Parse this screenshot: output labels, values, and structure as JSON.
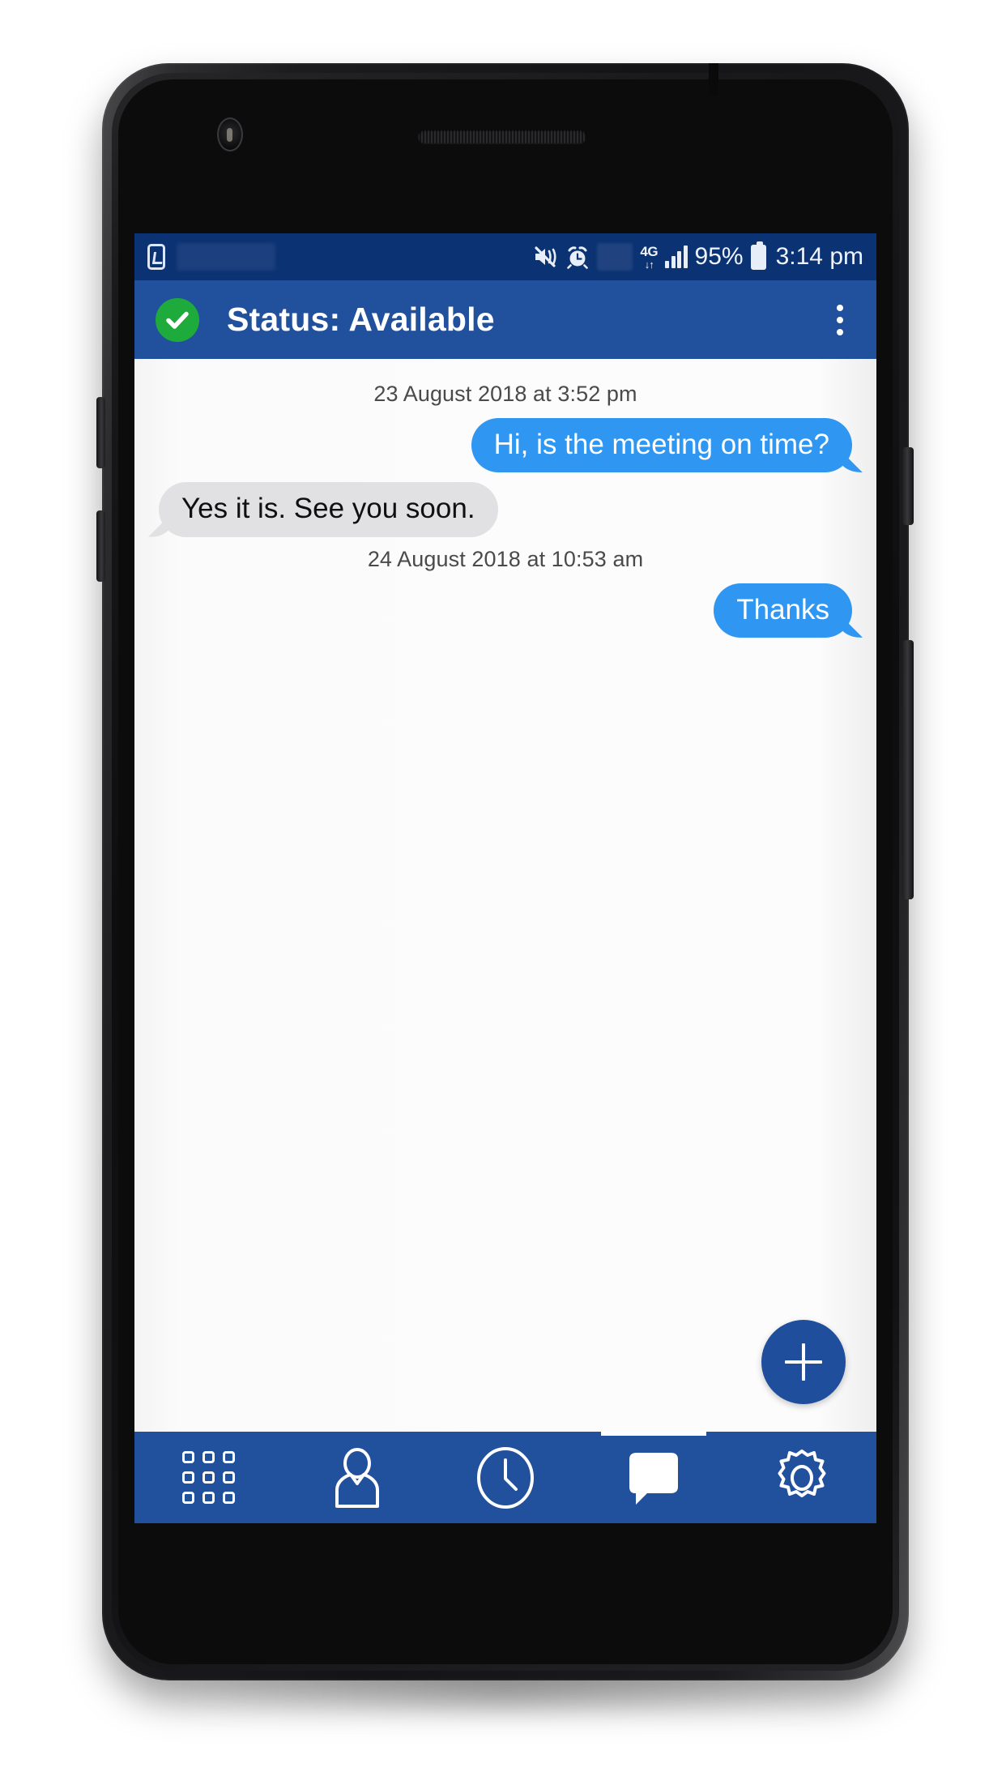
{
  "device": {
    "frame": "android-phone",
    "bezel_color": "#141416"
  },
  "status_bar": {
    "background": "#0b3272",
    "left_icons": [
      "sim-card-icon",
      "carrier-name-redacted"
    ],
    "right_icons": [
      "mute-vibrate-icon",
      "alarm-icon",
      "redacted-icon"
    ],
    "network_label": "4G",
    "network_arrows": "↓↑",
    "signal_bars": 4,
    "battery_percent": "95%",
    "time": "3:14 pm"
  },
  "app_bar": {
    "background": "#21509d",
    "status_icon": "check-circle-icon",
    "status_icon_color": "#1faa3c",
    "title": "Status: Available",
    "overflow_menu": "more-vertical-icon"
  },
  "chat": {
    "background": "#fbfbfb",
    "bubble_out_color": "#2f97f2",
    "bubble_in_color": "#e1e1e3",
    "items": [
      {
        "kind": "timestamp",
        "text": "23 August 2018 at 3:52 pm"
      },
      {
        "kind": "message",
        "side": "out",
        "text": "Hi, is the meeting on time?"
      },
      {
        "kind": "message",
        "side": "in",
        "text": "Yes it is. See you soon."
      },
      {
        "kind": "timestamp",
        "text": "24 August 2018 at 10:53 am"
      },
      {
        "kind": "message",
        "side": "out",
        "text": "Thanks"
      }
    ]
  },
  "fab": {
    "icon": "plus-icon",
    "color": "#1f4e9c",
    "label": "+"
  },
  "bottom_nav": {
    "background": "#21509d",
    "active_index": 3,
    "items": [
      {
        "icon": "dialpad-icon",
        "name": "keypad"
      },
      {
        "icon": "person-icon",
        "name": "contacts"
      },
      {
        "icon": "clock-icon",
        "name": "history"
      },
      {
        "icon": "chat-bubble-icon",
        "name": "messages"
      },
      {
        "icon": "gear-icon",
        "name": "settings"
      }
    ]
  }
}
